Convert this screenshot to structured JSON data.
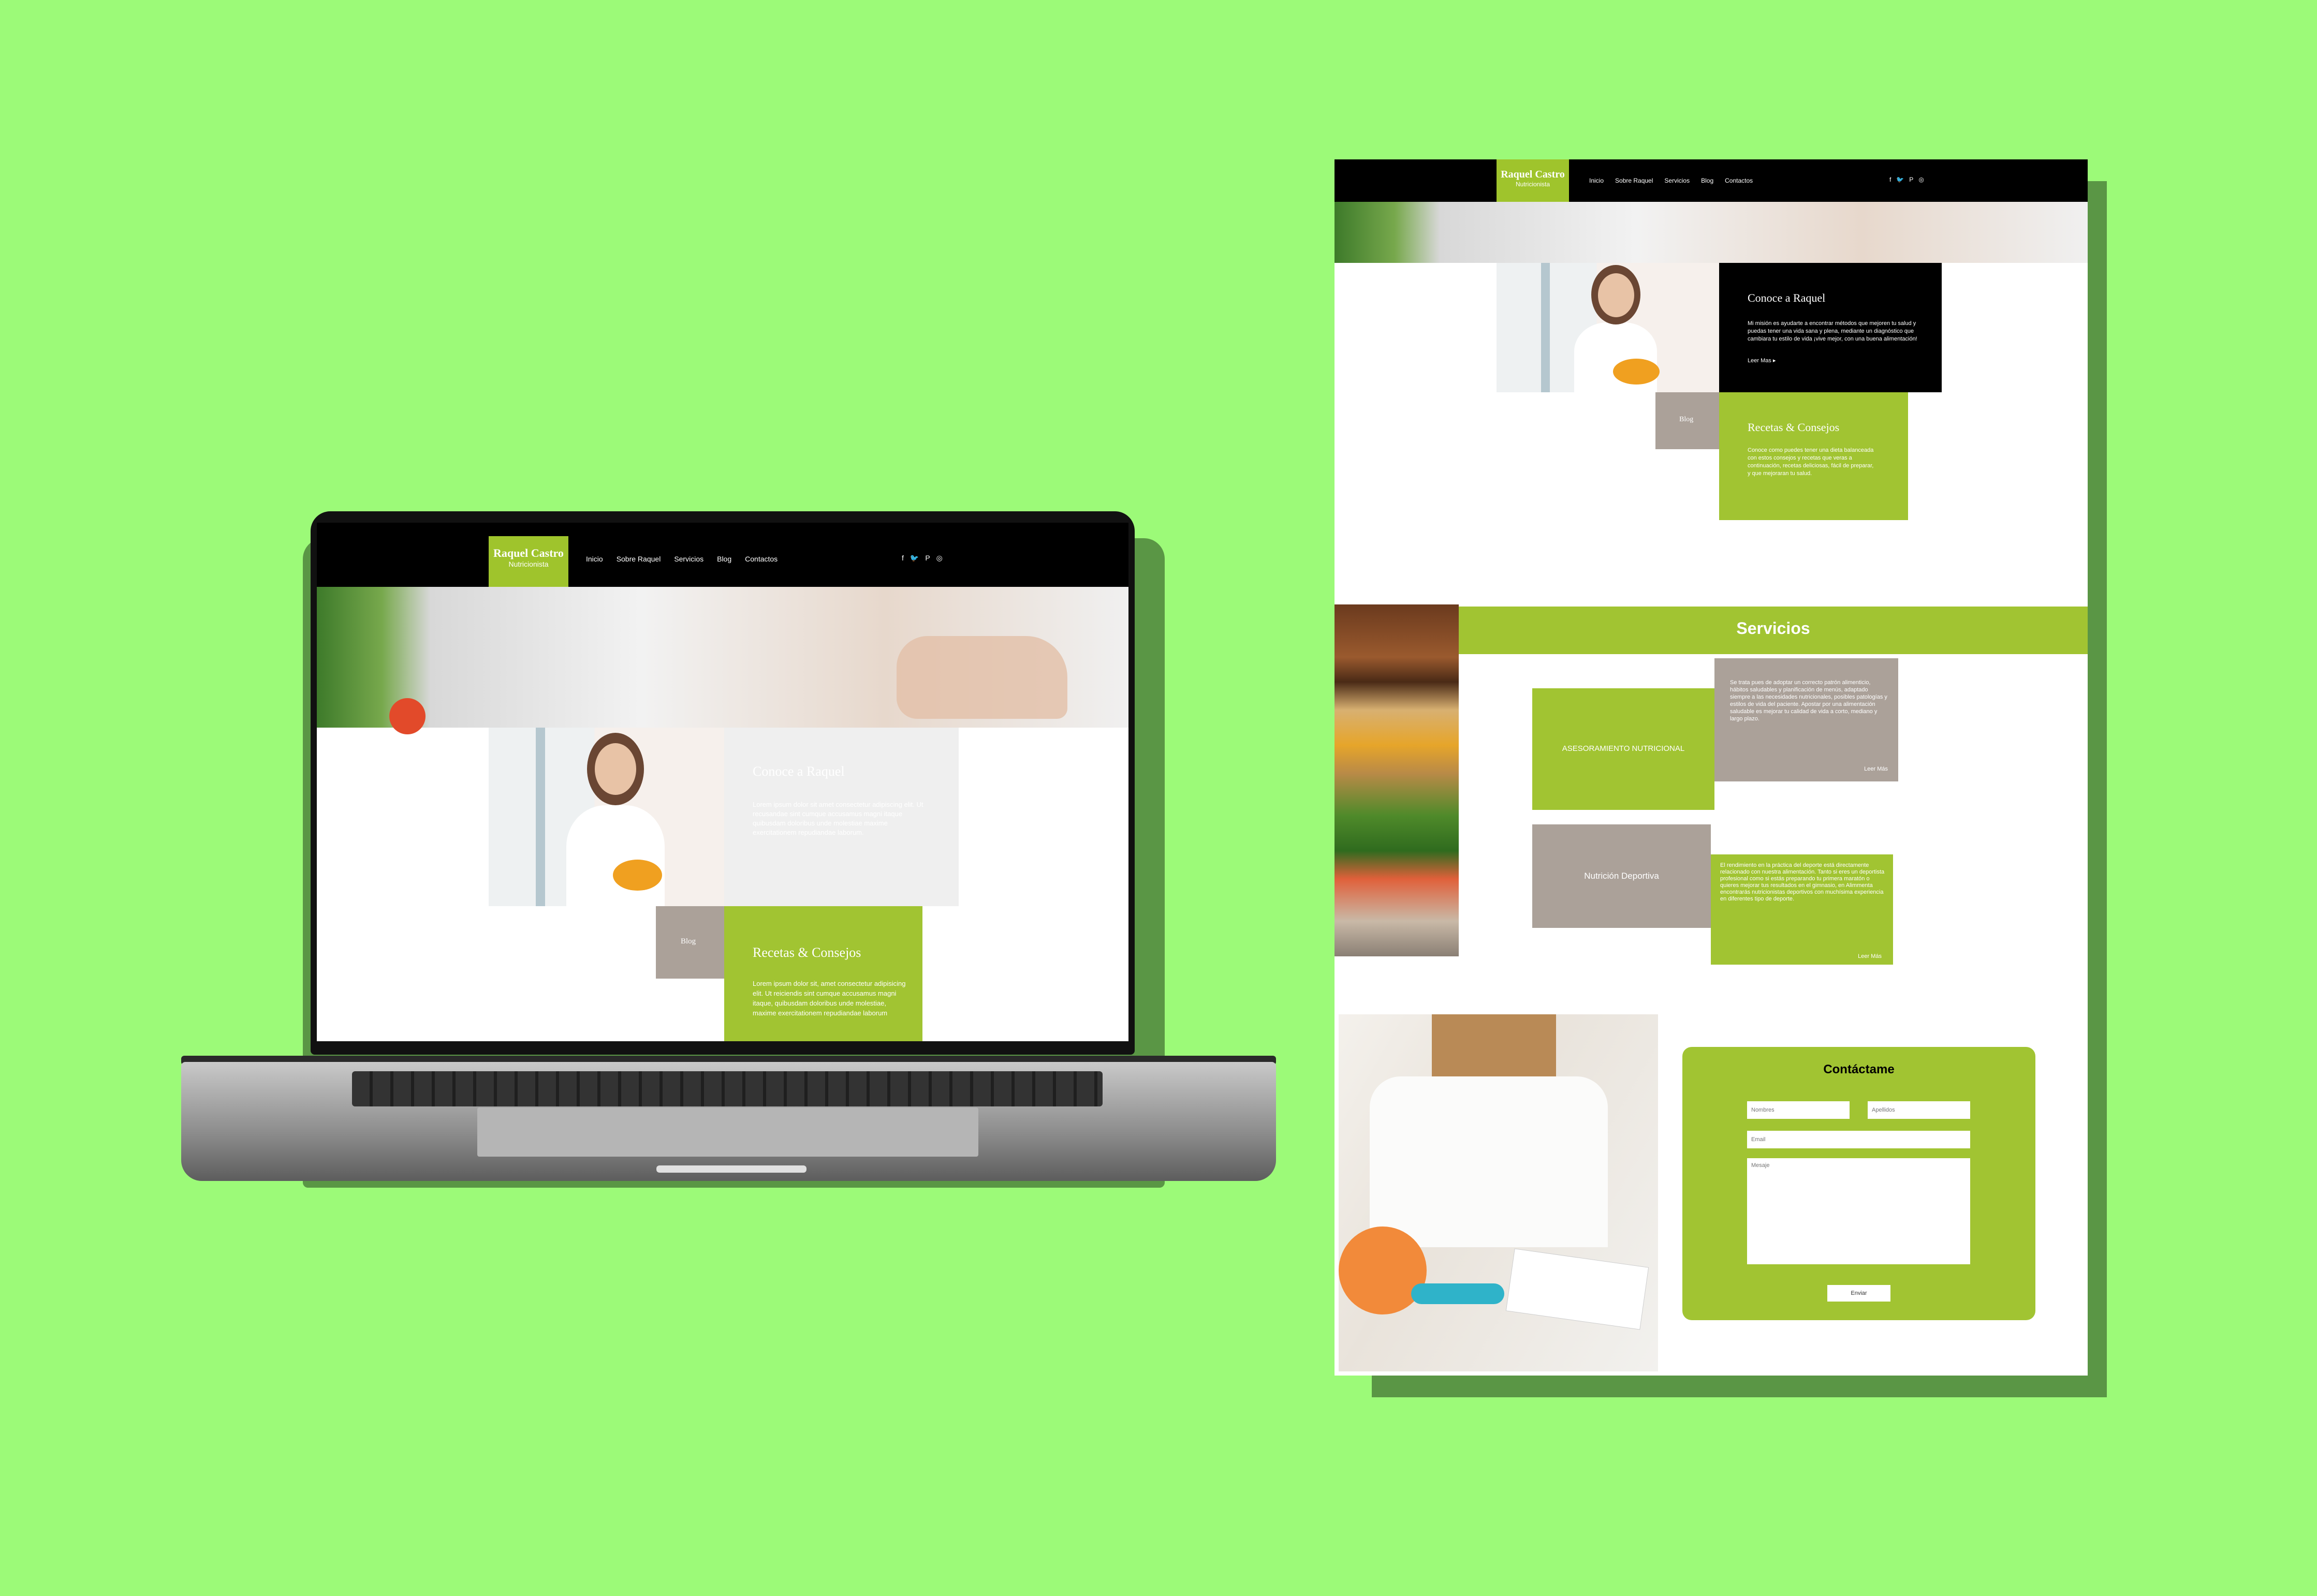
{
  "brand": {
    "name": "Raquel Castro",
    "tagline": "Nutricionista"
  },
  "nav": {
    "items": [
      "Inicio",
      "Sobre Raquel",
      "Servicios",
      "Blog",
      "Contactos"
    ]
  },
  "social": {
    "facebook": "f",
    "twitter": "🐦",
    "pinterest": "P",
    "instagram": "◎"
  },
  "laptop": {
    "about": {
      "title": "Conoce a Raquel",
      "text": "Lorem ipsum dolor sit amet consectetur adipiscing elit. Ut recusandae sint cumque accusamus magni itaque quibusdam doloribus unde molestiae maxime exercitationem repudiandae laborum."
    },
    "blog_label": "Blog",
    "recipes": {
      "title": "Recetas & Consejos",
      "text": "Lorem ipsum dolor sit, amet consectetur adipisicing elit. Ut reiciendis sint cumque accusamus magni itaque, quibusdam doloribus unde molestiae, maxime exercitationem repudiandae laborum"
    }
  },
  "page": {
    "about": {
      "title": "Conoce a Raquel",
      "text": "Mi misión es ayudarte a encontrar métodos que mejoren tu salud y puedas tener una vida sana y plena, mediante un diagnóstico que cambiara tu estilo de vida ¡vive mejor, con una buena alimentación!",
      "more": "Leer Mas ▸"
    },
    "blog_label": "Blog",
    "recipes": {
      "title": "Recetas & Consejos",
      "text": "Conoce como puedes tener una dieta balanceada con estos consejos y recetas que veras a continuación, recetas deliciosas, fácil de preparar, y que mejoraran tu salud."
    },
    "services": {
      "title": "Servicios",
      "items": [
        {
          "label": "ASESORAMIENTO NUTRICIONAL",
          "text": "Se trata pues de adoptar un correcto patrón alimenticio, hábitos saludables y planificación de menús, adaptado siempre a las necesidades nutricionales, posibles patologías y estilos de vida del paciente. Apostar por una alimentación saludable es mejorar tu calidad de vida a corto, mediano y largo plazo.",
          "more": "Leer Más"
        },
        {
          "label": "Nutrición Deportiva",
          "text": "El rendimiento en la práctica del deporte está directamente relacionado con nuestra alimentación. Tanto si eres un deportista profesional como si estás preparando tu primera maratón o quieres mejorar tus resultados en el gimnasio, en Alimmenta encontrarás nutricionistas deportivos con muchísima experiencia en diferentes tipo de deporte.",
          "more": "Leer Más"
        }
      ]
    },
    "contact": {
      "title": "Contáctame",
      "name_placeholder": "Nombres",
      "surname_placeholder": "Apellidos",
      "email_placeholder": "Email",
      "message_placeholder": "Mesaje",
      "submit": "Enviar"
    }
  },
  "colors": {
    "background": "#9cfa78",
    "accent": "#a1c432",
    "taupe": "#aba199",
    "nav": "#000000"
  }
}
